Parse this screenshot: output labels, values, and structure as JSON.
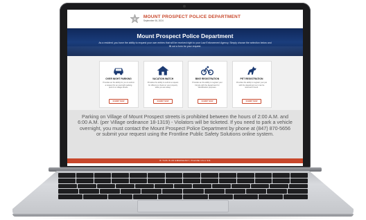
{
  "header": {
    "title": "MOUNT PROSPECT POLICE DEPARTMENT",
    "date": "September 06, 2024"
  },
  "hero": {
    "title": "Mount Prospect Police Department",
    "subtitle": "As a resident, you have the ability to request your own entries that will be received right to your Law Enforcement Agency. Simply choose the selection below and fill out a form for your request."
  },
  "cards": [
    {
      "icon": "car-icon",
      "title": "OVER NIGHT PARKING",
      "description": "Provides an the ability for you to submit a request for an overnight parking permit on village streets.",
      "button": "SUBMIT NOW"
    },
    {
      "icon": "house-icon",
      "title": "VACATION WATCH",
      "description": "Provides the ability to submit a request for officers to check on your property while you are away.",
      "button": "SUBMIT NOW"
    },
    {
      "icon": "bicycle-icon",
      "title": "BIKE REGISTRATION",
      "description": "Provides an the ability to register your bicycle with the department for identification purposes.",
      "button": "SUBMIT NOW"
    },
    {
      "icon": "dog-icon",
      "title": "PET REGISTRATION",
      "description": "Provides the ability to register your pet with the department so it can be returned if found.",
      "button": "SUBMIT NOW"
    }
  ],
  "notice": {
    "text": "Parking on Village of Mount Prospect streets is prohibited between the hours of 2:00 A.M. and 6:00 A.M. (per Village ordinance 18-1319) - Violators will be ticketed. If you need to park a vehicle overnight, you must contact the Mount Prospect Police Department by phone at (847) 870-5656 or submit your request using the Frontline Public Safety Solutions online system."
  },
  "footer_bar": {
    "text": "IF THIS IS AN EMERGENCY, PLEASE CALL 911"
  },
  "colors": {
    "accent": "#c8472b",
    "hero_bg": "#1a3d7c",
    "notice_bg": "#e2e2e2"
  }
}
